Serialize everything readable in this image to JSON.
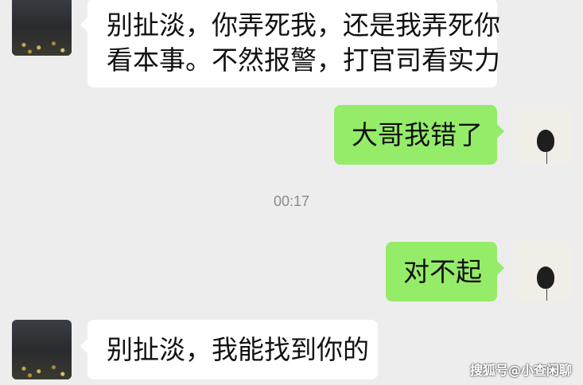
{
  "messages": [
    {
      "side": "left",
      "text": "别扯淡，你弄死我，还是我弄死你看本事。不然报警，打官司看实力",
      "lines": [
        "别扯淡，你弄死我，还是我弄死你",
        "看本事。不然报警，打官司看实力"
      ]
    },
    {
      "side": "right",
      "text": "大哥我错了"
    },
    {
      "timestamp": "00:17"
    },
    {
      "side": "right",
      "text": "对不起"
    },
    {
      "side": "left",
      "text": "别扯淡，我能找到你的"
    }
  ],
  "watermark": "搜狐号@小查闲聊",
  "colors": {
    "background": "#ededed",
    "incoming_bubble": "#ffffff",
    "outgoing_bubble": "#95ec69",
    "timestamp_text": "#8a8a8a"
  },
  "icons": {
    "contact_avatar": "night-city-avatar",
    "self_avatar": "doll-avatar"
  }
}
